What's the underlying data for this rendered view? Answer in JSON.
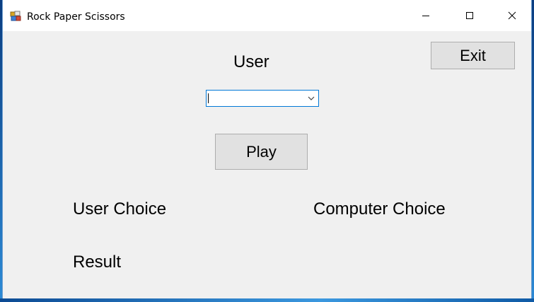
{
  "window": {
    "title": "Rock Paper Scissors",
    "icon": "app-icon",
    "controls": [
      "minimize-icon",
      "maximize-icon",
      "close-icon"
    ]
  },
  "form": {
    "user_label": "User",
    "user_choice_combo": {
      "value": "",
      "options": []
    },
    "play_button": "Play",
    "exit_button": "Exit",
    "user_choice_label": "User Choice",
    "computer_choice_label": "Computer Choice",
    "result_label": "Result"
  },
  "colors": {
    "client_background": "#f0f0f0",
    "button_face": "#e1e1e1",
    "button_border": "#adadad",
    "focus_border": "#0078d7"
  }
}
